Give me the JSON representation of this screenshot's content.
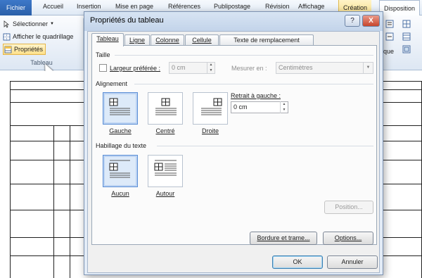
{
  "ribbon": {
    "tabs": [
      "Fichier",
      "Accueil",
      "Insertion",
      "Mise en page",
      "Références",
      "Publipostage",
      "Révision",
      "Affichage",
      "Création",
      "Disposition"
    ],
    "items": [
      "Sélectionner",
      "Afficher le quadrillage",
      "Propriétés"
    ],
    "group_label": "Tableau",
    "right_partial": "que"
  },
  "dialog": {
    "title": "Propriétés du tableau",
    "help_label": "?",
    "close_label": "X",
    "tabs": [
      "Tableau",
      "Ligne",
      "Colonne",
      "Cellule",
      "Texte de remplacement"
    ],
    "taille": {
      "section": "Taille",
      "preferred_width_label": "Largeur préférée :",
      "preferred_width_value": "0 cm",
      "measure_label": "Mesurer en :",
      "measure_value": "Centimètres"
    },
    "alignment": {
      "section": "Alignement",
      "options": [
        "Gauche",
        "Centré",
        "Droite"
      ],
      "indent_label": "Retrait à gauche :",
      "indent_value": "0 cm"
    },
    "wrapping": {
      "section": "Habillage du texte",
      "options": [
        "Aucun",
        "Autour"
      ],
      "position_button": "Position..."
    },
    "borders_button": "Bordure et trame...",
    "options_button": "Options...",
    "ok_button": "OK",
    "cancel_button": "Annuler"
  }
}
